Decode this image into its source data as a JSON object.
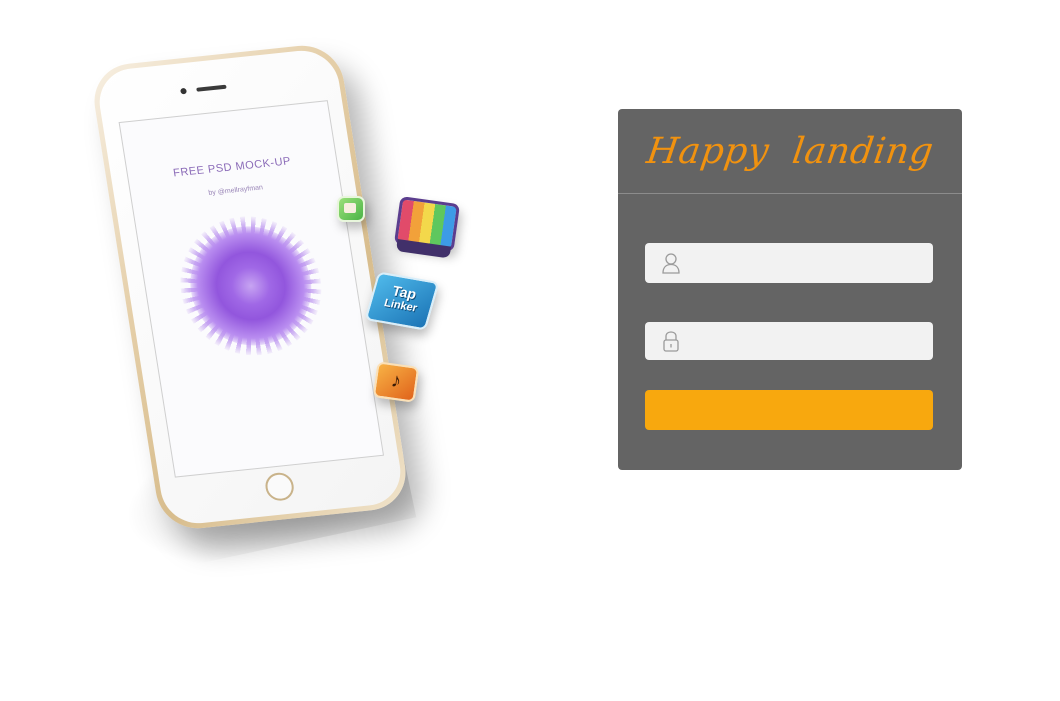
{
  "illustration": {
    "screen_title": "FREE PSD MOCK-UP",
    "screen_byline": "by @mellrayfman",
    "apps": [
      "tv-app-icon",
      "tap-linker-app-icon",
      "music-app-icon",
      "small-green-app-icon"
    ],
    "tap_linker_line1": "Tap",
    "tap_linker_line2": "Linker",
    "music_glyph": "♪"
  },
  "login": {
    "title": "Happy  landing",
    "username": {
      "value": "",
      "placeholder": "",
      "icon": "user-icon"
    },
    "password": {
      "value": "",
      "placeholder": "",
      "icon": "lock-icon"
    },
    "submit_label": ""
  },
  "colors": {
    "panel": "#646464",
    "title": "#f1920f",
    "input_bg": "#f2f2f2",
    "button": "#f8a80e",
    "background": "#ffffff"
  }
}
